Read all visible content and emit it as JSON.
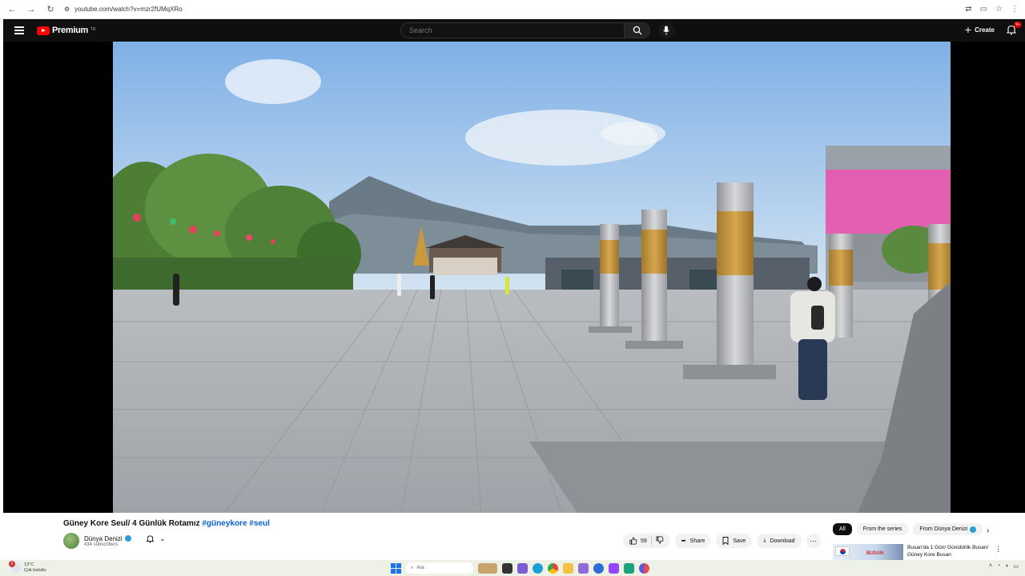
{
  "browser": {
    "url": "youtube.com/watch?v=mzr2fUMqXRo"
  },
  "header": {
    "logo_text": "Premium",
    "logo_region": "TR",
    "search_placeholder": "Search",
    "create_label": "Create",
    "notification_count": "9+"
  },
  "video": {
    "title_prefix": "Güney Kore Seul/ 4 Günlük Rotamız ",
    "hashtag1": "#güneykore",
    "hashtag2": "#seul"
  },
  "channel": {
    "name": "Dünya Denizi",
    "subscribers": "434 subscribers"
  },
  "actions": {
    "like_count": "59",
    "share_label": "Share",
    "save_label": "Save",
    "download_label": "Download"
  },
  "chips": [
    "All",
    "From the series",
    "From Dünya Denizi"
  ],
  "recommendation": {
    "thumb_text": "BUSAN",
    "title": "Busan'da 1 Gün/ Günübirlik Busan/ Güney Kore Busan"
  },
  "taskbar": {
    "temperature": "13°C",
    "weather": "Çok bulutlu",
    "weather_badge": "2",
    "search_placeholder": "Ara"
  },
  "colors": {
    "yt_red": "#ff0000",
    "link_blue": "#065fd4",
    "header_bg": "#0f0f0f"
  }
}
